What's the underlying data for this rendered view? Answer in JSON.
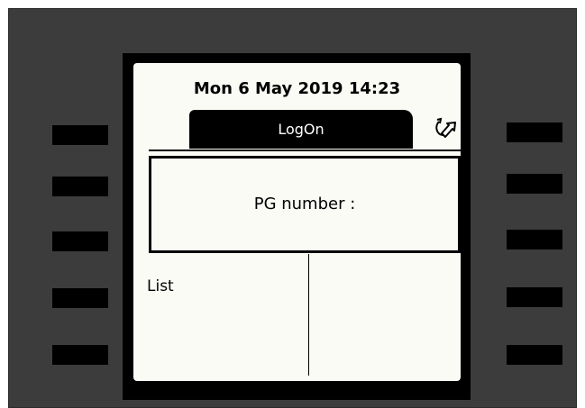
{
  "screen": {
    "datetime": "Mon 6 May 2019 14:23",
    "tab_label": "LogOn",
    "logoff_icon": "logoff-arrow-icon",
    "input_prompt": "PG number :",
    "left_softkey_label": "List"
  },
  "colors": {
    "body": "#3c3c3c",
    "bezel": "#000000",
    "screen": "#fbfbf6",
    "softkey": "#000000"
  }
}
